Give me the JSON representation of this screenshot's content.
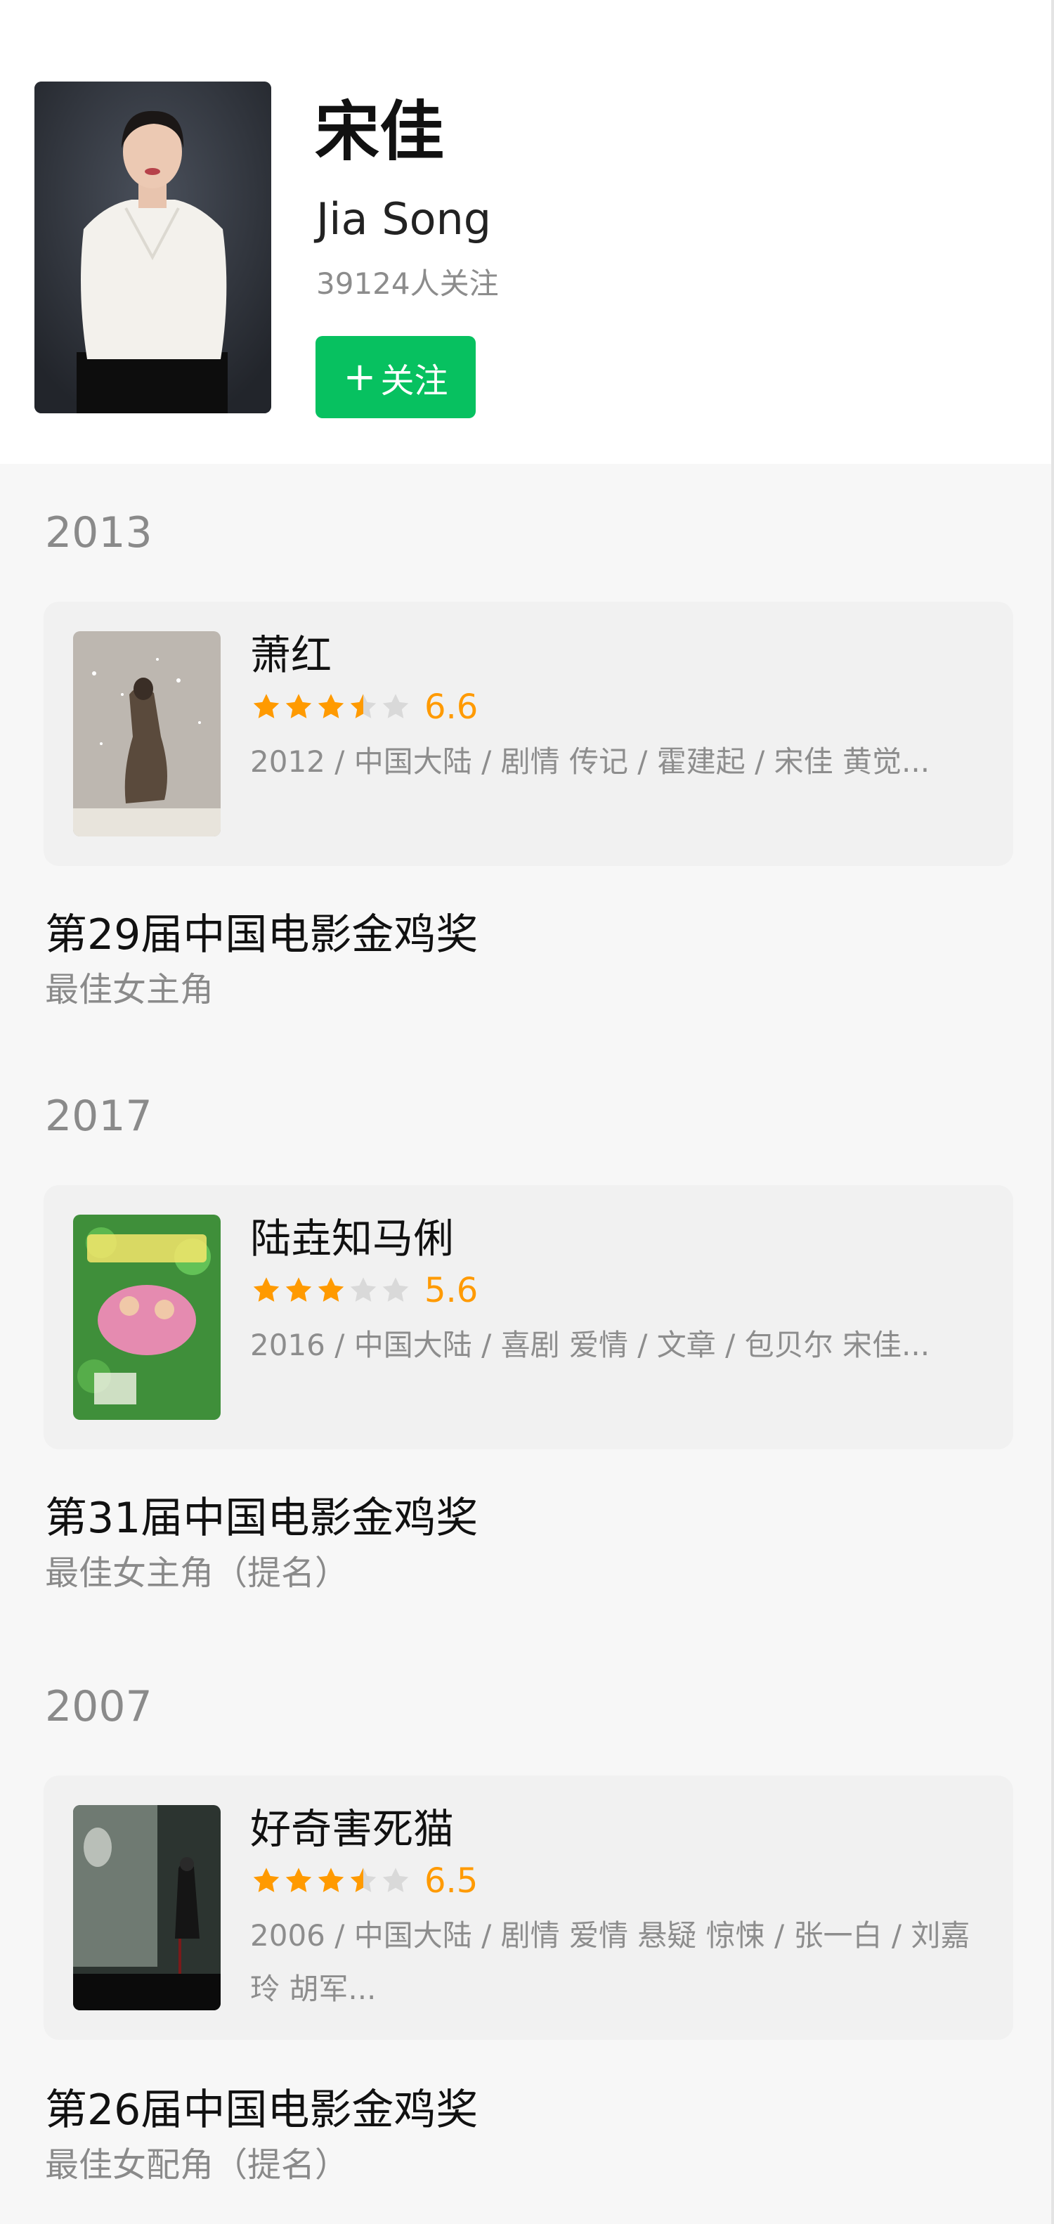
{
  "profile": {
    "name_cn": "宋佳",
    "name_en": "Jia Song",
    "followers": "39124人关注",
    "follow_button": "关注",
    "follow_icon": "+"
  },
  "colors": {
    "accent": "#07c160",
    "star": "#ff9a00",
    "star_empty": "#d9d9d9"
  },
  "entries": [
    {
      "year": "2013",
      "movie": {
        "title": "萧红",
        "rating_value": 3.5,
        "score": "6.6",
        "meta": "2012 / 中国大陆 / 剧情 传记 / 霍建起 / 宋佳 黄觉..."
      },
      "award": {
        "name": "第29届中国电影金鸡奖",
        "category": "最佳女主角"
      }
    },
    {
      "year": "2017",
      "movie": {
        "title": "陆垚知马俐",
        "rating_value": 3,
        "score": "5.6",
        "meta": "2016 / 中国大陆 / 喜剧 爱情 / 文章 / 包贝尔 宋佳..."
      },
      "award": {
        "name": "第31届中国电影金鸡奖",
        "category": "最佳女主角（提名）"
      }
    },
    {
      "year": "2007",
      "movie": {
        "title": "好奇害死猫",
        "rating_value": 3.5,
        "score": "6.5",
        "meta": "2006 / 中国大陆 / 剧情 爱情 悬疑 惊悚 / 张一白 / 刘嘉玲 胡军..."
      },
      "award": {
        "name": "第26届中国电影金鸡奖",
        "category": "最佳女配角（提名）"
      }
    }
  ]
}
